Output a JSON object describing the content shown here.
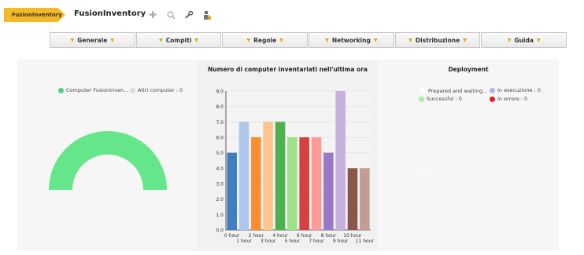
{
  "header": {
    "breadcrumb": "FusionInventory",
    "title": "FusionInventory",
    "icons": [
      "plus-icon",
      "search-icon",
      "wrench-icon",
      "user-config-icon"
    ]
  },
  "menu": {
    "items": [
      "Generale",
      "Compiti",
      "Regole",
      "Networking",
      "Distribuzione",
      "Guida"
    ]
  },
  "computers_panel": {
    "legend": [
      {
        "label": "Computer FusionInven...",
        "color": "#4cd37b"
      },
      {
        "label": "Altri computer : 0",
        "color": "#dddddd"
      }
    ],
    "gauge_fraction": 1.0,
    "gauge_color": "#66e68a"
  },
  "inventory_chart": {
    "title": "Numero di computer inventariati nell'ultima ora"
  },
  "deployment": {
    "title": "Deployment",
    "legend": [
      {
        "label": "Prepared and waiting...",
        "color": "#ffffff"
      },
      {
        "label": "In esecuzione : 0",
        "color": "#a9b8ee"
      },
      {
        "label": "Successful : 0",
        "color": "#a8efa8"
      },
      {
        "label": "In errore : 0",
        "color": "#e02020"
      }
    ]
  },
  "chart_data": {
    "type": "bar",
    "title": "Numero di computer inventariati nell'ultima ora",
    "categories": [
      "0 hour",
      "1 hour",
      "2 hour",
      "3 hour",
      "4 hour",
      "5 hour",
      "6 hour",
      "7 hour",
      "8 hour",
      "9 hour",
      "10 hour",
      "11 hour"
    ],
    "values": [
      5,
      7,
      6,
      7,
      7,
      6,
      6,
      6,
      5,
      9,
      4,
      4
    ],
    "colors": [
      "#3f7fbf",
      "#aec8ec",
      "#ff8c2e",
      "#ffc58d",
      "#4fb04f",
      "#9fe08a",
      "#d84040",
      "#ff9a96",
      "#9a78c8",
      "#c8b0dd",
      "#8c564b",
      "#c49c94"
    ],
    "yticks": [
      "0.0",
      "1.0",
      "2.0",
      "3.0",
      "4.0",
      "5.0",
      "6.0",
      "7.0",
      "8.0",
      "9.0"
    ],
    "ylim": [
      0,
      9
    ],
    "grid": true
  }
}
